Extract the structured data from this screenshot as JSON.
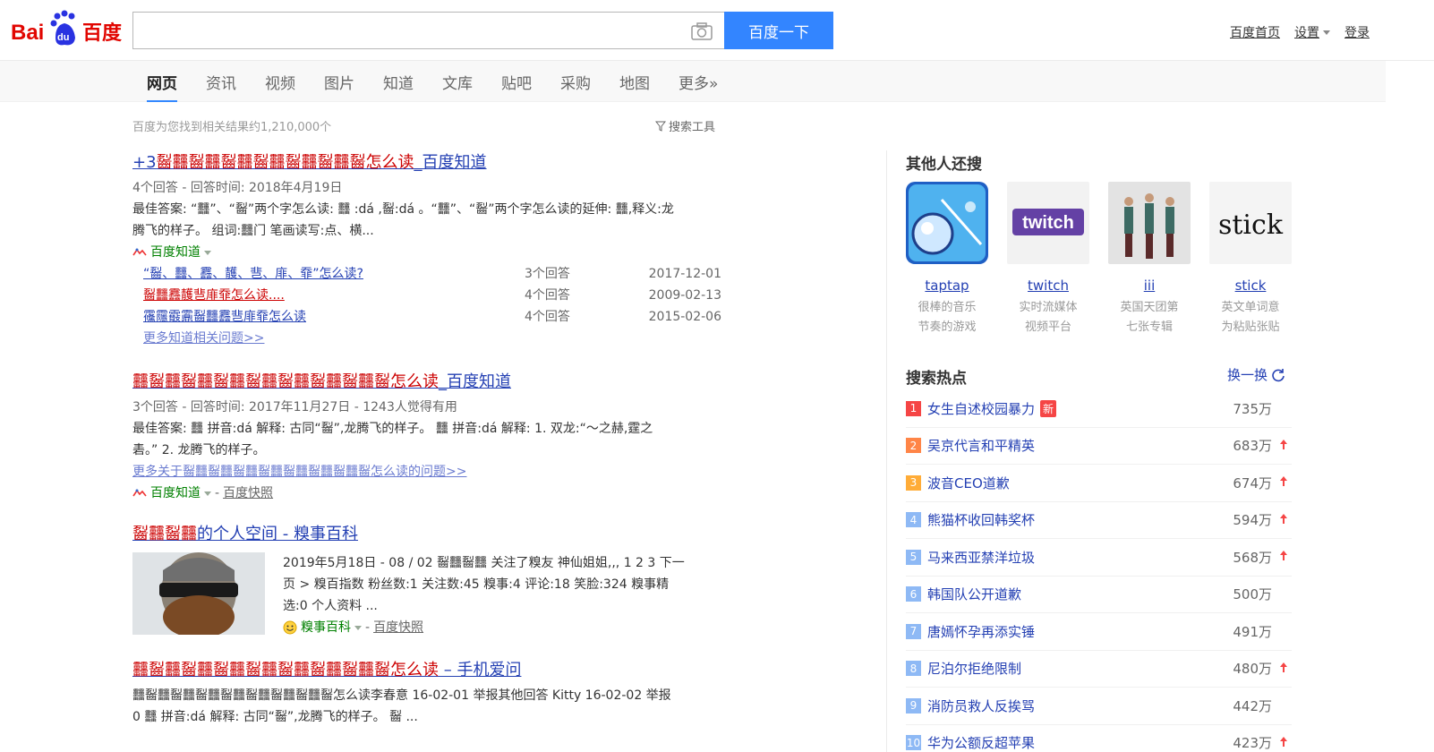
{
  "header": {
    "logo_text": "百度",
    "search_value": "",
    "search_button": "百度一下",
    "links": {
      "home": "百度首页",
      "settings": "设置",
      "login": "登录"
    }
  },
  "tabs": [
    "网页",
    "资讯",
    "视频",
    "图片",
    "知道",
    "文库",
    "贴吧",
    "采购",
    "地图",
    "更多»"
  ],
  "results_meta": {
    "count": "百度为您找到相关结果约1,210,000个",
    "tools": "搜索工具"
  },
  "results": [
    {
      "title_prefix": "+3",
      "title_hl": "䶛䨻䶛䨻䶛䨻䶛䨻䶛䨻䶛䨻䶛怎么读",
      "title_suffix": "_百度知道",
      "meta": "4个回答 - 回答时间: 2018年4月19日",
      "abstract_l1": "最佳答案: “䨻”、“䶛”两个字怎么读: 䨻 :dá ,䶛:dá 。“䨻”、“䶛”两个字怎么读的延伸: 䨻,释义:龙",
      "abstract_l2": "腾飞的样子。 组词:䨻门 笔画读写:点、横...",
      "source": "百度知道",
      "sub": [
        {
          "q": "“䶛、䨻、䨺、䨼、䨽、䨾、䨿”怎么读?",
          "c": "3个回答",
          "d": "2017-12-01"
        },
        {
          "q": "䶛䨻䨺䨼䨽䨾䨿怎么读....",
          "c": "4个回答",
          "d": "2009-02-13"
        },
        {
          "q": "䨹䨸䨷䨶䶛䨻䨺䨽䨾䨿怎么读",
          "c": "4个回答",
          "d": "2015-02-06"
        }
      ],
      "more": "更多知道相关问题>>"
    },
    {
      "title_hl": "䨻䶛䨻䶛䨻䶛䨻䶛䨻䶛䨻䶛䨻䶛䨻䶛怎么读",
      "title_suffix": "_百度知道",
      "meta": "3个回答 - 回答时间: 2017年11月27日 - 1243人觉得有用",
      "abstract_l1": "最佳答案: 䨻 拼音:dá 解释: 古同“䶛”,龙腾飞的样子。 䨻 拼音:dá 解释: 1. 双龙:“～之赫,霆之",
      "abstract_l2": "砉。” 2. 龙腾飞的样子。",
      "more": "更多关于䶛䨻䶛䨻䶛䨻䶛䨻䶛䨻䶛䨻䶛䨻䶛怎么读的问题>>",
      "source": "百度知道",
      "snapshot": "百度快照"
    },
    {
      "title_hl": "䶛䨻䶛䨻",
      "title_suffix": "的个人空间 - 糗事百科",
      "abstract_l1": "2019年5月18日 - 08 / 02 䶛䨻䶛䨻 关注了糗友 神仙姐姐,,, 1 2 3 下一",
      "abstract_l2": "页 > 糗百指数 粉丝数:1 关注数:45 糗事:4 评论:18 笑脸:324 糗事精",
      "abstract_l3": "选:0 个人资料 ...",
      "source": "糗事百科",
      "snapshot": "百度快照"
    },
    {
      "title_hl": "䨻䶛䨻䶛䨻䶛䨻䶛䨻䶛䨻䶛䨻䶛䨻䶛怎么读",
      "title_suffix": " – 手机爱问",
      "abstract_l1": "䨻䶛䨻䶛䨻䶛䨻䶛䨻䶛䨻䶛䨻䶛䨻䶛怎么读李春意 16-02-01 举报其他回答 Kitty 16-02-02 举报",
      "abstract_l2": "0 䨻 拼音:dá 解释: 古同“䶛”,龙腾飞的样子。 䶛 ..."
    }
  ],
  "right": {
    "related_title": "其他人还搜",
    "related": [
      {
        "name": "taptap",
        "desc1": "很棒的音乐",
        "desc2": "节奏的游戏",
        "icon": "game-ball-icon"
      },
      {
        "name": "twitch",
        "desc1": "实时流媒体",
        "desc2": "视频平台",
        "icon": "twitch-logo"
      },
      {
        "name": "iii",
        "desc1": "英国天团第",
        "desc2": "七张专辑",
        "icon": "album-cover"
      },
      {
        "name": "stick",
        "desc1": "英文单词意",
        "desc2": "为粘贴张贴",
        "icon": "stick-word"
      }
    ],
    "stick_word": "stick",
    "twitch_word": "twitch",
    "hot_title": "搜索热点",
    "refresh": "换一换",
    "new_badge": "新",
    "hot": [
      {
        "rank": "1",
        "name": "女生自述校园暴力",
        "val": "735万",
        "new": true,
        "up": false
      },
      {
        "rank": "2",
        "name": "吴京代言和平精英",
        "val": "683万",
        "new": false,
        "up": true
      },
      {
        "rank": "3",
        "name": "波音CEO道歉",
        "val": "674万",
        "new": false,
        "up": true
      },
      {
        "rank": "4",
        "name": "熊猫杯收回韩奖杯",
        "val": "594万",
        "new": false,
        "up": true
      },
      {
        "rank": "5",
        "name": "马来西亚禁洋垃圾",
        "val": "568万",
        "new": false,
        "up": true
      },
      {
        "rank": "6",
        "name": "韩国队公开道歉",
        "val": "500万",
        "new": false,
        "up": false
      },
      {
        "rank": "7",
        "name": "唐嫣怀孕再添实锤",
        "val": "491万",
        "new": false,
        "up": false
      },
      {
        "rank": "8",
        "name": "尼泊尔拒绝限制",
        "val": "480万",
        "new": false,
        "up": true
      },
      {
        "rank": "9",
        "name": "消防员救人反挨骂",
        "val": "442万",
        "new": false,
        "up": false
      },
      {
        "rank": "10",
        "name": "华为公额反超苹果",
        "val": "423万",
        "new": false,
        "up": true
      }
    ],
    "rank_colors": {
      "top1": "#f54545",
      "top2": "#ff8547",
      "top3": "#ffac38",
      "rest": "#8eb9f5"
    }
  }
}
